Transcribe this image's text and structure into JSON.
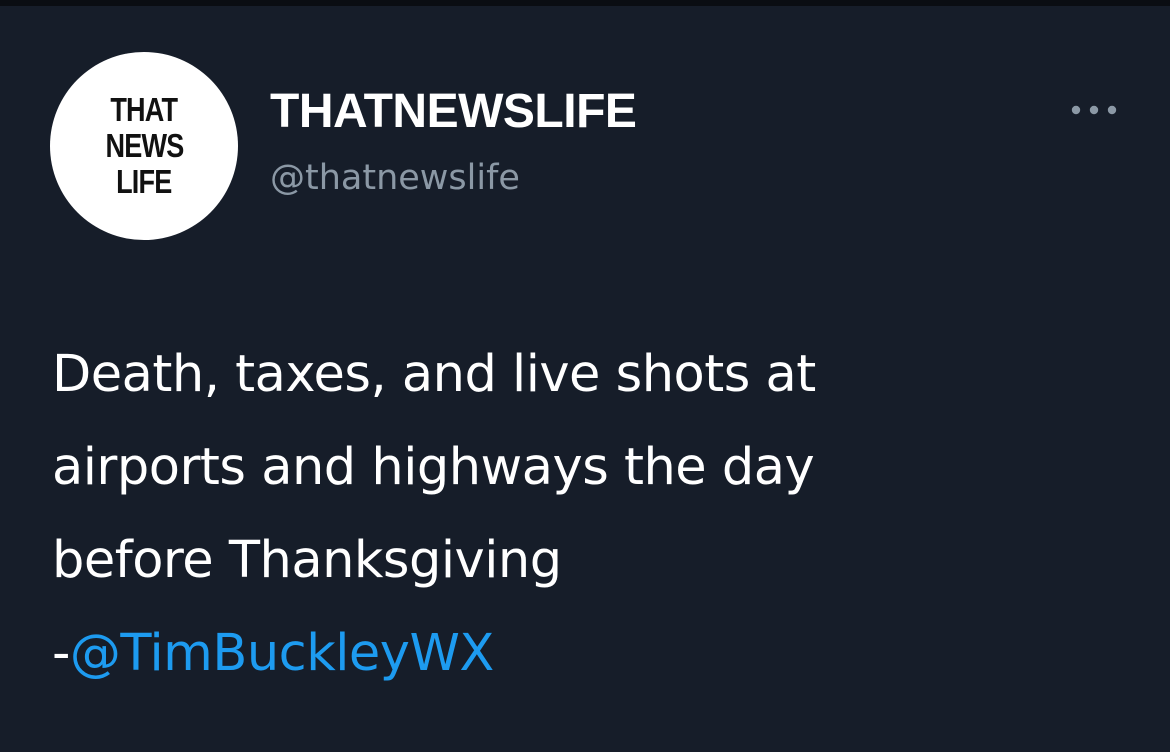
{
  "avatar": {
    "lines": [
      "THAT",
      "NEWS",
      "LIFE"
    ]
  },
  "user": {
    "display_name": "THATNEWSLIFE",
    "handle": "@thatnewslife"
  },
  "more_icon": "more-horizontal-icon",
  "tweet": {
    "lines": [
      "Death, taxes, and live shots at",
      "airports and highways the day",
      "before Thanksgiving"
    ],
    "attribution_prefix": "-",
    "mention": "@TimBuckleyWX"
  },
  "colors": {
    "background": "#161d29",
    "text": "#ffffff",
    "secondary_text": "#8b98a5",
    "link": "#1d9bf0"
  }
}
